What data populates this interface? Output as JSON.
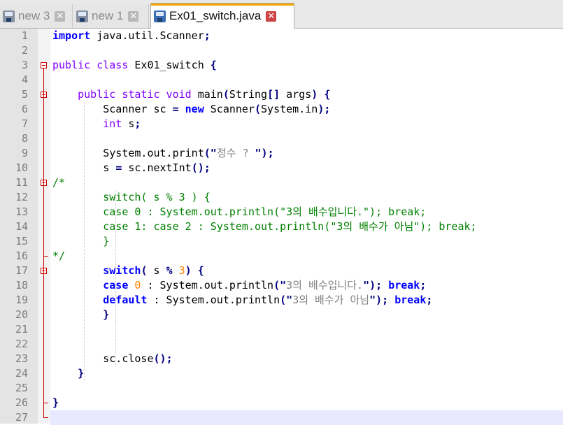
{
  "tabs": [
    {
      "label": "new 3",
      "active": false
    },
    {
      "label": "new 1",
      "active": false
    },
    {
      "label": "Ex01_switch.java",
      "active": true
    }
  ],
  "close_glyph": "✕",
  "lines": [
    {
      "n": "1",
      "text": "import java.util.Scanner;"
    },
    {
      "n": "2",
      "text": ""
    },
    {
      "n": "3",
      "text": "public class Ex01_switch {"
    },
    {
      "n": "4",
      "text": ""
    },
    {
      "n": "5",
      "text": "    public static void main(String[] args) {"
    },
    {
      "n": "6",
      "text": "        Scanner sc = new Scanner(System.in);"
    },
    {
      "n": "7",
      "text": "        int s;"
    },
    {
      "n": "8",
      "text": ""
    },
    {
      "n": "9",
      "text": "        System.out.print(\"정수 ? \");"
    },
    {
      "n": "10",
      "text": "        s = sc.nextInt();"
    },
    {
      "n": "11",
      "text": "/*"
    },
    {
      "n": "12",
      "text": "        switch( s % 3 ) {"
    },
    {
      "n": "13",
      "text": "        case 0 : System.out.println(\"3의 배수입니다.\"); break;"
    },
    {
      "n": "14",
      "text": "        case 1: case 2 : System.out.println(\"3의 배수가 아님\"); break;"
    },
    {
      "n": "15",
      "text": "        }"
    },
    {
      "n": "16",
      "text": "*/"
    },
    {
      "n": "17",
      "text": "        switch( s % 3) {"
    },
    {
      "n": "18",
      "text": "        case 0 : System.out.println(\"3의 배수입니다.\"); break;"
    },
    {
      "n": "19",
      "text": "        default : System.out.println(\"3의 배수가 아님\"); break;"
    },
    {
      "n": "20",
      "text": "        }"
    },
    {
      "n": "21",
      "text": ""
    },
    {
      "n": "22",
      "text": ""
    },
    {
      "n": "23",
      "text": "        sc.close();"
    },
    {
      "n": "24",
      "text": "    }"
    },
    {
      "n": "25",
      "text": ""
    },
    {
      "n": "26",
      "text": "}"
    },
    {
      "n": "27",
      "text": ""
    }
  ],
  "colors": {
    "keyword": "#0000ff",
    "type": "#8000ff",
    "string": "#808080",
    "number": "#ff8000",
    "comment": "#008000",
    "current_line": "#e8e8ff",
    "fold_marker": "#cc0000",
    "active_tab_accent": "#f7a600"
  },
  "current_line": 27
}
